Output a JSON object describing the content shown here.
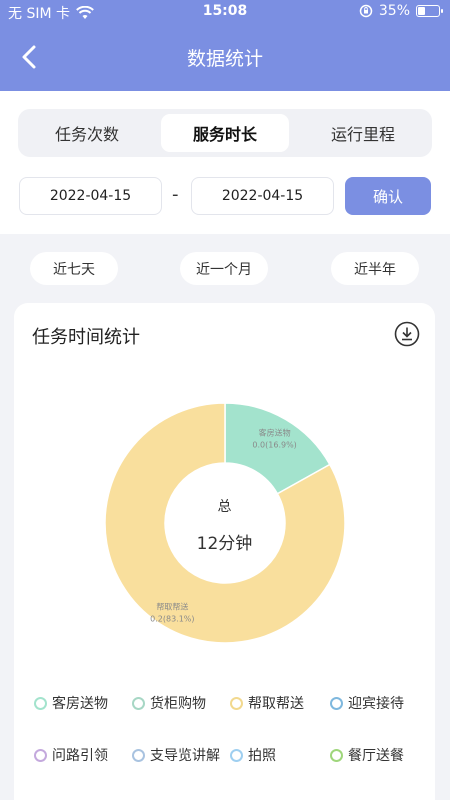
{
  "status_bar": {
    "carrier": "无 SIM 卡",
    "time": "15:08",
    "battery": "35%",
    "battery_level": 0.35
  },
  "header": {
    "title": "数据统计"
  },
  "tabs": [
    {
      "label": "任务次数",
      "active": false
    },
    {
      "label": "服务时长",
      "active": true
    },
    {
      "label": "运行里程",
      "active": false
    }
  ],
  "date_range": {
    "start": "2022-04-15",
    "separator": "-",
    "end": "2022-04-15",
    "confirm_label": "确认"
  },
  "quick_ranges": [
    "近七天",
    "近一个月",
    "近半年"
  ],
  "card": {
    "title": "任务时间统计"
  },
  "chart_data": {
    "type": "pie",
    "title": "任务时间统计",
    "center_label": "总",
    "total": "12分钟",
    "slices": [
      {
        "name": "客房送物",
        "value": 0.0,
        "percent": 16.9,
        "label": "0.0(16.9%)",
        "color": "#a3e3cd"
      },
      {
        "name": "帮取帮送",
        "value": 0.2,
        "percent": 83.1,
        "label": "0.2(83.1%)",
        "color": "#f9df9d"
      }
    ]
  },
  "legend": [
    {
      "label": "客房送物",
      "color": "#a3e3cd"
    },
    {
      "label": "货柜购物",
      "color": "#a7d7c5"
    },
    {
      "label": "帮取帮送",
      "color": "#f2d98f"
    },
    {
      "label": "迎宾接待",
      "color": "#7fb8de"
    },
    {
      "label": "问路引领",
      "color": "#c4a9dd"
    },
    {
      "label": "支导览讲解",
      "color": "#a9c3e0"
    },
    {
      "label": "拍照",
      "color": "#9fcff0"
    },
    {
      "label": "餐厅送餐",
      "color": "#9fd67c"
    }
  ]
}
